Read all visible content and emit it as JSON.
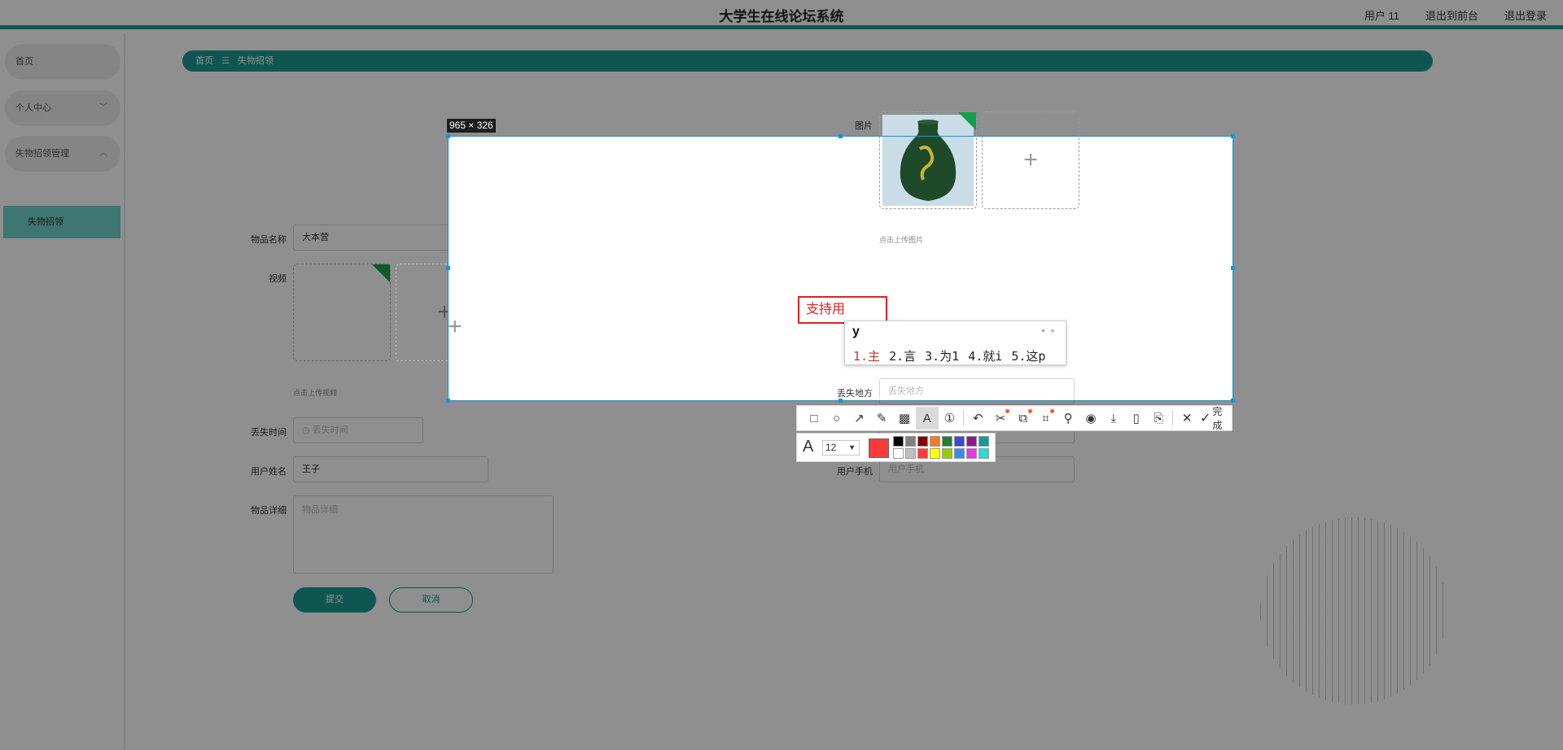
{
  "app": {
    "title": "大学生在线论坛系统"
  },
  "header": {
    "user": "用户 11",
    "back_front": "退出到前台",
    "logout": "退出登录"
  },
  "sidebar": {
    "items": [
      {
        "label": "首页",
        "chevron": ""
      },
      {
        "label": "个人中心",
        "chevron": "﹀"
      },
      {
        "label": "失物招领管理",
        "chevron": "︿"
      }
    ],
    "sub_item": "失物招领"
  },
  "breadcrumb": {
    "home": "首页",
    "separator": "☰",
    "current": "失物招领"
  },
  "form": {
    "name_label": "物品名称",
    "name_value": "大本营",
    "video_label": "视频",
    "video_hint": "点击上传视频",
    "image_label": "图片",
    "image_hint": "点击上传图片",
    "lost_time_label": "丢失时间",
    "lost_time_placeholder": "丢失时间",
    "clock_icon": "◷",
    "lost_place_label": "丢失地方",
    "lost_place_placeholder": "丢失地方",
    "user_name_label": "用户姓名",
    "user_name_value": "王子",
    "phone_label": "用户手机",
    "phone_placeholder": "用户手机",
    "detail_label": "物品详细",
    "detail_placeholder": "物品详细",
    "submit": "提交",
    "cancel": "取消",
    "plus": "+"
  },
  "screenshot": {
    "size_label": "965 × 326",
    "text_entry": "支持用",
    "ime": {
      "input": "y",
      "arrows": "◂ ▸",
      "candidates": [
        "1.主",
        "2.言",
        "3.为1",
        "4.就i",
        "5.这p"
      ]
    },
    "toolbar": {
      "tools": [
        {
          "icon": "rectangle-icon",
          "glyph": "□",
          "active": false
        },
        {
          "icon": "ellipse-icon",
          "glyph": "○",
          "active": false
        },
        {
          "icon": "arrow-icon",
          "glyph": "↗",
          "active": false
        },
        {
          "icon": "pencil-icon",
          "glyph": "✎",
          "active": false
        },
        {
          "icon": "mosaic-icon",
          "glyph": "▩",
          "active": false
        },
        {
          "icon": "text-icon",
          "glyph": "A",
          "active": true
        },
        {
          "icon": "number-icon",
          "glyph": "①",
          "active": false
        },
        {
          "icon": "undo-icon",
          "glyph": "↶",
          "active": false
        },
        {
          "icon": "scissors-icon",
          "glyph": "✂",
          "active": false
        },
        {
          "icon": "translate-icon",
          "glyph": "⧉",
          "active": false
        },
        {
          "icon": "ocr-icon",
          "glyph": "⌗",
          "active": false
        },
        {
          "icon": "pin-icon",
          "glyph": "⚲",
          "active": false
        },
        {
          "icon": "record-icon",
          "glyph": "◉",
          "active": false
        },
        {
          "icon": "download-icon",
          "glyph": "⤓",
          "active": false
        },
        {
          "icon": "phone-icon",
          "glyph": "▯",
          "active": false
        },
        {
          "icon": "bookmark-icon",
          "glyph": "⎘",
          "active": false
        },
        {
          "icon": "close-icon",
          "glyph": "✕",
          "active": false
        }
      ],
      "done_label": "完成",
      "check_glyph": "✓"
    },
    "text_options": {
      "font_glyph": "A",
      "font_size": "12",
      "dropdown_glyph": "▼",
      "current_color": "#fb3b3b",
      "palette": [
        "#000000",
        "#808080",
        "#800000",
        "#f27c29",
        "#2a7a3a",
        "#3b49d4",
        "#8a1a8a",
        "#159a9a",
        "#ffffff",
        "#c0c0c0",
        "#fb3b3b",
        "#ffff00",
        "#99cc00",
        "#3b8ce8",
        "#e838e8",
        "#30d8d8"
      ]
    }
  }
}
